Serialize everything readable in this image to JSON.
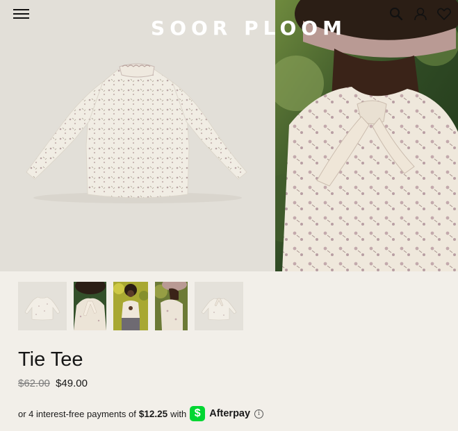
{
  "header": {
    "logo": "SOOR PLOOM",
    "icons": [
      "menu-icon",
      "search-icon",
      "account-icon",
      "wishlist-icon"
    ]
  },
  "gallery": {
    "main_images": [
      "tie-tee-flat-front",
      "tie-tee-back-tie-worn"
    ],
    "thumbnails": [
      "tie-tee-flat-front",
      "tie-tee-back-tie-worn",
      "tie-tee-front-worn",
      "tie-tee-side-worn",
      "tie-tee-flat-back"
    ]
  },
  "product": {
    "title": "Tie Tee",
    "price_original": "$62.00",
    "price_sale": "$49.00"
  },
  "afterpay": {
    "prefix": "or 4 interest-free payments of",
    "amount": "$12.25",
    "with": "with",
    "cashapp_glyph": "$",
    "brand": "Afterpay",
    "info_glyph": "i",
    "brand_color": "#00d632"
  }
}
